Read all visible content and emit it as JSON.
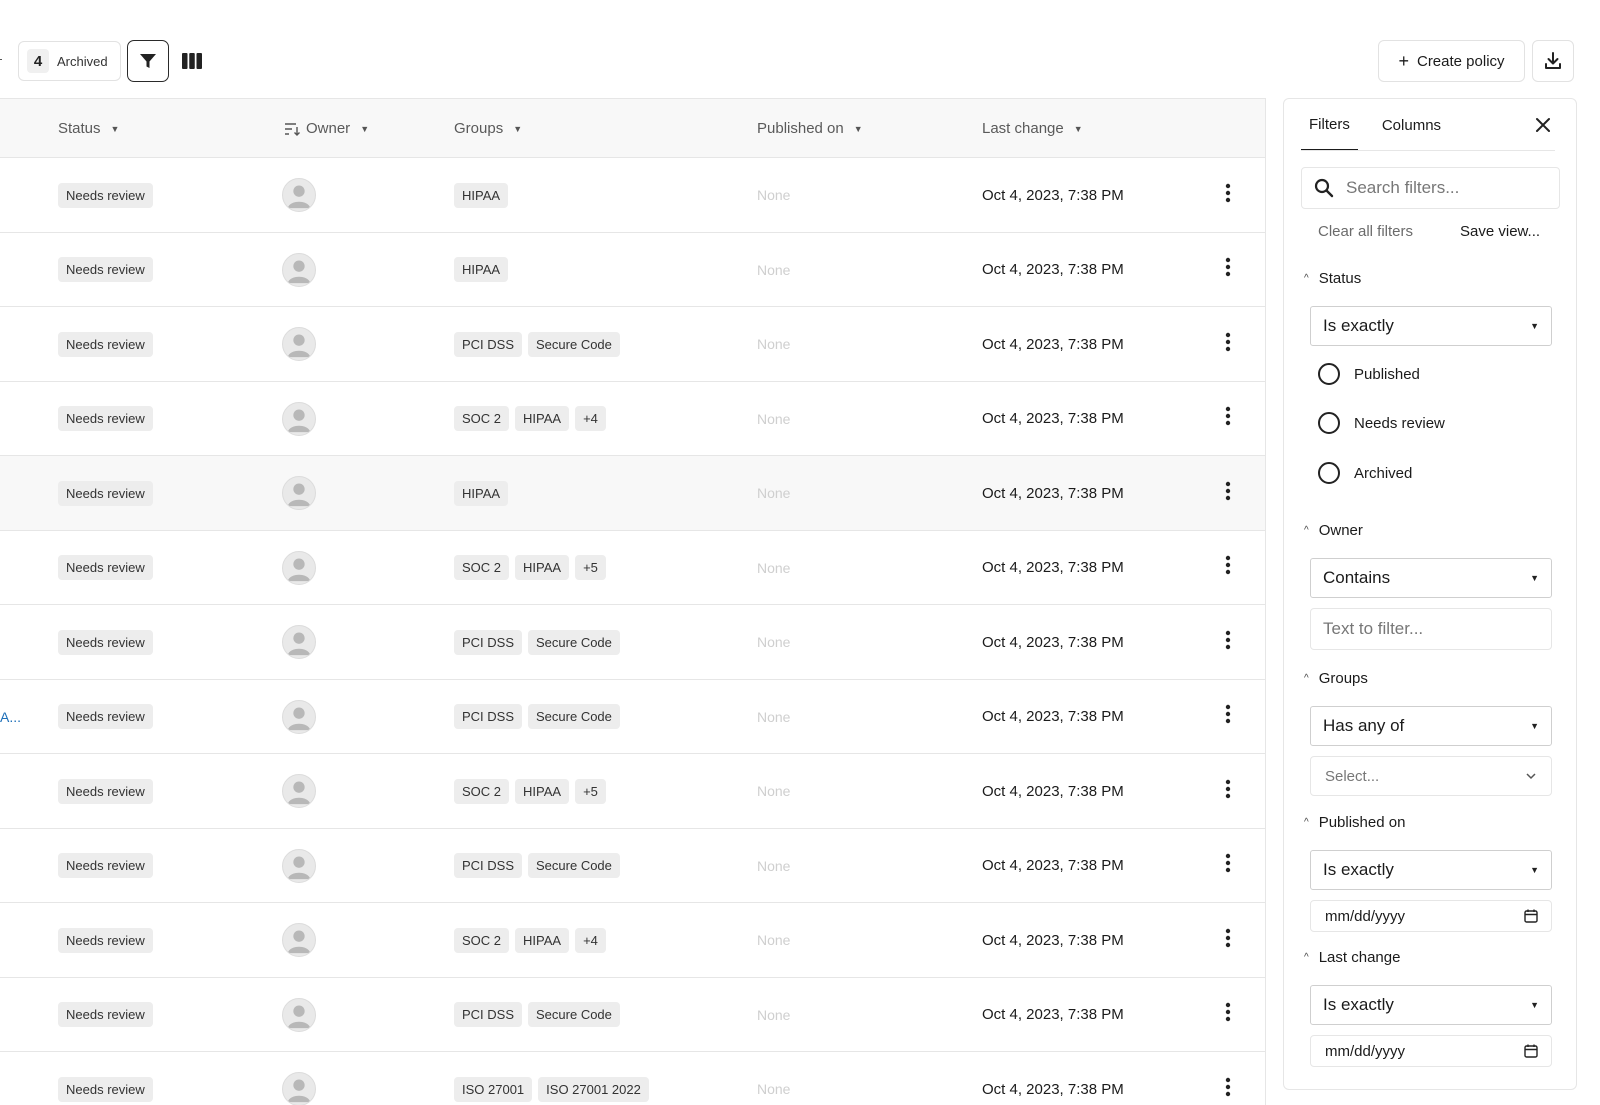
{
  "toolbar": {
    "archived_count": "4",
    "archived_label": "Archived",
    "filter_icon": "filter-icon",
    "columns_icon": "columns-icon",
    "create_label": "Create policy",
    "create_icon": "plus-icon",
    "download_icon": "download-icon"
  },
  "table": {
    "headers": {
      "status": "Status",
      "owner": "Owner",
      "groups": "Groups",
      "published": "Published on",
      "last_change": "Last change"
    },
    "rows": [
      {
        "status": "Needs review",
        "groups": [
          "HIPAA"
        ],
        "published": "None",
        "last_change": "Oct 4, 2023, 7:38 PM"
      },
      {
        "status": "Needs review",
        "groups": [
          "HIPAA"
        ],
        "published": "None",
        "last_change": "Oct 4, 2023, 7:38 PM"
      },
      {
        "status": "Needs review",
        "groups": [
          "PCI DSS",
          "Secure Code"
        ],
        "published": "None",
        "last_change": "Oct 4, 2023, 7:38 PM"
      },
      {
        "status": "Needs review",
        "groups": [
          "SOC 2",
          "HIPAA",
          "+4"
        ],
        "published": "None",
        "last_change": "Oct 4, 2023, 7:38 PM"
      },
      {
        "status": "Needs review",
        "groups": [
          "HIPAA"
        ],
        "published": "None",
        "last_change": "Oct 4, 2023, 7:38 PM",
        "hover": true
      },
      {
        "status": "Needs review",
        "groups": [
          "SOC 2",
          "HIPAA",
          "+5"
        ],
        "published": "None",
        "last_change": "Oct 4, 2023, 7:38 PM"
      },
      {
        "status": "Needs review",
        "groups": [
          "PCI DSS",
          "Secure Code"
        ],
        "published": "None",
        "last_change": "Oct 4, 2023, 7:38 PM"
      },
      {
        "status": "Needs review",
        "groups": [
          "PCI DSS",
          "Secure Code"
        ],
        "published": "None",
        "last_change": "Oct 4, 2023, 7:38 PM",
        "truncated_name": "A..."
      },
      {
        "status": "Needs review",
        "groups": [
          "SOC 2",
          "HIPAA",
          "+5"
        ],
        "published": "None",
        "last_change": "Oct 4, 2023, 7:38 PM"
      },
      {
        "status": "Needs review",
        "groups": [
          "PCI DSS",
          "Secure Code"
        ],
        "published": "None",
        "last_change": "Oct 4, 2023, 7:38 PM"
      },
      {
        "status": "Needs review",
        "groups": [
          "SOC 2",
          "HIPAA",
          "+4"
        ],
        "published": "None",
        "last_change": "Oct 4, 2023, 7:38 PM"
      },
      {
        "status": "Needs review",
        "groups": [
          "PCI DSS",
          "Secure Code"
        ],
        "published": "None",
        "last_change": "Oct 4, 2023, 7:38 PM"
      },
      {
        "status": "Needs review",
        "groups": [
          "ISO 27001",
          "ISO 27001 2022"
        ],
        "published": "None",
        "last_change": "Oct 4, 2023, 7:38 PM"
      }
    ]
  },
  "panel": {
    "tabs": [
      "Filters",
      "Columns"
    ],
    "active_tab": "Filters",
    "search_placeholder": "Search filters...",
    "clear_label": "Clear all filters",
    "save_label": "Save view...",
    "status": {
      "title": "Status",
      "operator": "Is exactly",
      "options": [
        "Published",
        "Needs review",
        "Archived"
      ]
    },
    "owner": {
      "title": "Owner",
      "operator": "Contains",
      "placeholder": "Text to filter..."
    },
    "groups": {
      "title": "Groups",
      "operator": "Has any of",
      "placeholder": "Select..."
    },
    "published": {
      "title": "Published on",
      "operator": "Is exactly",
      "date_placeholder": "mm/dd/yyyy"
    },
    "last_change": {
      "title": "Last change",
      "operator": "Is exactly",
      "date_placeholder": "mm/dd/yyyy"
    }
  }
}
